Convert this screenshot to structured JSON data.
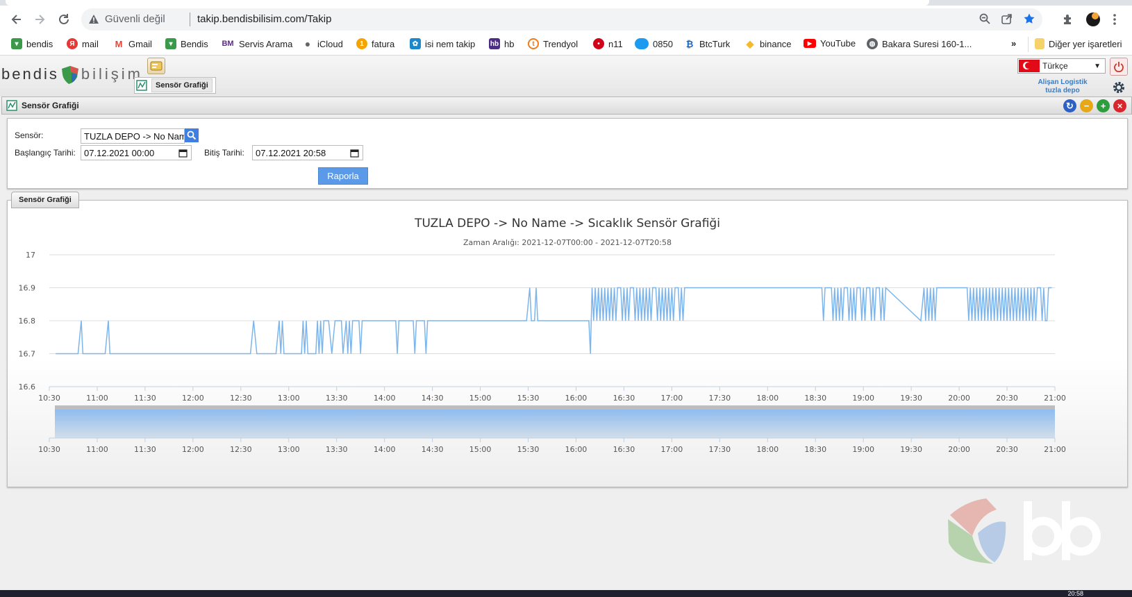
{
  "browser": {
    "security_label": "Güvenli değil",
    "url": "takip.bendisbilisim.com/Takip",
    "bookmarks": [
      {
        "label": "bendis",
        "icon": "bendis-icon",
        "color": "#3a9a4a"
      },
      {
        "label": "mail",
        "icon": "yandex-mail-icon",
        "color": "#e53935"
      },
      {
        "label": "Gmail",
        "icon": "gmail-icon",
        "color": "#ea4335"
      },
      {
        "label": "Bendis",
        "icon": "bendis-icon",
        "color": "#3a9a4a"
      },
      {
        "label": "Servis Arama",
        "icon": "bm-icon",
        "color": "#5b2a86"
      },
      {
        "label": "iCloud",
        "icon": "apple-icon",
        "color": "#666666"
      },
      {
        "label": "fatura",
        "icon": "fatura-icon",
        "color": "#f4a300"
      },
      {
        "label": "isi nem takip",
        "icon": "sensor-icon",
        "color": "#1a88c9"
      },
      {
        "label": "hb",
        "icon": "hb-icon",
        "color": "#4b2e83"
      },
      {
        "label": "Trendyol",
        "icon": "trendyol-icon",
        "color": "#f27a1a"
      },
      {
        "label": "n11",
        "icon": "n11-icon",
        "color": "#d0021b"
      },
      {
        "label": "0850",
        "icon": "cloud-icon",
        "color": "#1d9bf0"
      },
      {
        "label": "BtcTurk",
        "icon": "btcturk-icon",
        "color": "#1565c0"
      },
      {
        "label": "binance",
        "icon": "binance-icon",
        "color": "#f3ba2f"
      },
      {
        "label": "YouTube",
        "icon": "youtube-icon",
        "color": "#ff0000"
      },
      {
        "label": "Bakara Suresi 160-1...",
        "icon": "globe-icon",
        "color": "#5f6368"
      }
    ],
    "more_label": "»",
    "other_bookmarks": "Diğer yer işaretleri"
  },
  "app": {
    "logo_left": "bendis",
    "logo_right": "bilişim",
    "open_tab": "Sensör Grafiği",
    "language": "Türkçe",
    "company_line1": "Alişan Logistik",
    "company_line2": "tuzla depo"
  },
  "window": {
    "title": "Sensör Grafiği",
    "controls": {
      "refresh": "↻",
      "minimize": "−",
      "maximize": "+",
      "close": "×"
    }
  },
  "filter": {
    "sensor_label": "Sensör:",
    "sensor_value": "TUZLA DEPO -> No Name",
    "start_label": "Başlangıç Tarihi:",
    "start_value": "07.12.2021 00:00",
    "end_label": "Bitiş Tarihi:",
    "end_value": "07.12.2021 20:58",
    "report_button": "Raporla"
  },
  "graph_tab": "Sensör Grafiği",
  "colors": {
    "line": "#7cb5ec",
    "accent": "#5b9ae9"
  },
  "chart_data": {
    "type": "line",
    "title": "TUZLA DEPO -> No Name -> Sıcaklık Sensör Grafiği",
    "subtitle": "Zaman Aralığı: 2021-12-07T00:00 - 2021-12-07T20:58",
    "ylim": [
      16.6,
      17
    ],
    "yticks": [
      "16.6",
      "16.7",
      "16.8",
      "16.9",
      "17"
    ],
    "xticks": [
      "10:30",
      "11:00",
      "11:30",
      "12:00",
      "12:30",
      "13:00",
      "13:30",
      "14:00",
      "14:30",
      "15:00",
      "15:30",
      "16:00",
      "16:30",
      "17:00",
      "17:30",
      "18:00",
      "18:30",
      "19:00",
      "19:30",
      "20:00",
      "20:30",
      "21:00"
    ],
    "grid": true,
    "legend": "none",
    "navigator": true,
    "series": [
      {
        "points": [
          [
            "10:34",
            16.7
          ],
          [
            "10:48",
            16.7
          ],
          [
            "10:50",
            16.8
          ],
          [
            "10:51",
            16.7
          ],
          [
            "11:05",
            16.7
          ],
          [
            "11:07",
            16.8
          ],
          [
            "11:08",
            16.7
          ],
          [
            "12:36",
            16.7
          ],
          [
            "12:38",
            16.8
          ],
          [
            "12:40",
            16.7
          ],
          [
            "12:52",
            16.7
          ],
          [
            "12:54",
            16.8
          ],
          [
            "12:55",
            16.7
          ],
          [
            "12:56",
            16.8
          ],
          [
            "12:57",
            16.7
          ],
          [
            "13:08",
            16.7
          ],
          [
            "13:09",
            16.8
          ],
          [
            "13:10",
            16.7
          ],
          [
            "13:11",
            16.8
          ],
          [
            "13:12",
            16.7
          ],
          [
            "13:17",
            16.7
          ],
          [
            "13:18",
            16.8
          ],
          [
            "13:19",
            16.7
          ],
          [
            "13:20",
            16.8
          ],
          [
            "13:21",
            16.7
          ],
          [
            "13:22",
            16.8
          ],
          [
            "13:25",
            16.8
          ],
          [
            "13:27",
            16.7
          ],
          [
            "13:29",
            16.8
          ],
          [
            "13:33",
            16.8
          ],
          [
            "13:34",
            16.7
          ],
          [
            "13:36",
            16.8
          ],
          [
            "13:37",
            16.7
          ],
          [
            "13:38",
            16.8
          ],
          [
            "13:39",
            16.7
          ],
          [
            "13:40",
            16.8
          ],
          [
            "13:44",
            16.8
          ],
          [
            "13:45",
            16.7
          ],
          [
            "13:46",
            16.8
          ],
          [
            "14:07",
            16.8
          ],
          [
            "14:08",
            16.7
          ],
          [
            "14:09",
            16.8
          ],
          [
            "14:18",
            16.8
          ],
          [
            "14:19",
            16.7
          ],
          [
            "14:20",
            16.8
          ],
          [
            "14:25",
            16.8
          ],
          [
            "14:26",
            16.7
          ],
          [
            "14:27",
            16.8
          ],
          [
            "15:29",
            16.8
          ],
          [
            "15:31",
            16.9
          ],
          [
            "15:32",
            16.8
          ],
          [
            "15:34",
            16.8
          ],
          [
            "15:35",
            16.9
          ],
          [
            "15:36",
            16.8
          ],
          [
            "16:08",
            16.8
          ],
          [
            "16:09",
            16.7
          ],
          [
            "16:10",
            16.9
          ],
          [
            "16:11",
            16.8
          ],
          [
            "16:12",
            16.9
          ],
          [
            "16:13",
            16.8
          ],
          [
            "16:14",
            16.9
          ],
          [
            "16:15",
            16.8
          ],
          [
            "16:16",
            16.9
          ],
          [
            "16:17",
            16.8
          ],
          [
            "16:18",
            16.9
          ],
          [
            "16:19",
            16.8
          ],
          [
            "16:20",
            16.9
          ],
          [
            "16:21",
            16.8
          ],
          [
            "16:22",
            16.9
          ],
          [
            "16:23",
            16.8
          ],
          [
            "16:24",
            16.9
          ],
          [
            "16:25",
            16.8
          ],
          [
            "16:26",
            16.9
          ],
          [
            "16:28",
            16.9
          ],
          [
            "16:29",
            16.8
          ],
          [
            "16:30",
            16.9
          ],
          [
            "16:31",
            16.8
          ],
          [
            "16:32",
            16.9
          ],
          [
            "16:33",
            16.8
          ],
          [
            "16:34",
            16.9
          ],
          [
            "16:36",
            16.9
          ],
          [
            "16:37",
            16.8
          ],
          [
            "16:38",
            16.9
          ],
          [
            "16:39",
            16.8
          ],
          [
            "16:40",
            16.9
          ],
          [
            "16:41",
            16.8
          ],
          [
            "16:42",
            16.9
          ],
          [
            "16:43",
            16.8
          ],
          [
            "16:44",
            16.9
          ],
          [
            "16:45",
            16.8
          ],
          [
            "16:46",
            16.9
          ],
          [
            "16:47",
            16.8
          ],
          [
            "16:48",
            16.9
          ],
          [
            "16:50",
            16.9
          ],
          [
            "16:51",
            16.8
          ],
          [
            "16:52",
            16.9
          ],
          [
            "16:53",
            16.8
          ],
          [
            "16:54",
            16.9
          ],
          [
            "16:55",
            16.8
          ],
          [
            "16:56",
            16.9
          ],
          [
            "16:57",
            16.8
          ],
          [
            "16:58",
            16.9
          ],
          [
            "16:59",
            16.8
          ],
          [
            "17:00",
            16.9
          ],
          [
            "17:01",
            16.8
          ],
          [
            "17:02",
            16.9
          ],
          [
            "17:04",
            16.9
          ],
          [
            "17:05",
            16.8
          ],
          [
            "17:06",
            16.9
          ],
          [
            "17:07",
            16.8
          ],
          [
            "17:08",
            16.9
          ],
          [
            "18:34",
            16.9
          ],
          [
            "18:35",
            16.8
          ],
          [
            "18:36",
            16.9
          ],
          [
            "18:40",
            16.9
          ],
          [
            "18:41",
            16.8
          ],
          [
            "18:42",
            16.9
          ],
          [
            "18:43",
            16.8
          ],
          [
            "18:44",
            16.9
          ],
          [
            "18:45",
            16.8
          ],
          [
            "18:46",
            16.9
          ],
          [
            "18:47",
            16.8
          ],
          [
            "18:48",
            16.9
          ],
          [
            "18:50",
            16.9
          ],
          [
            "18:51",
            16.8
          ],
          [
            "18:52",
            16.9
          ],
          [
            "18:53",
            16.8
          ],
          [
            "18:54",
            16.9
          ],
          [
            "18:55",
            16.8
          ],
          [
            "18:56",
            16.9
          ],
          [
            "18:58",
            16.9
          ],
          [
            "18:59",
            16.8
          ],
          [
            "19:00",
            16.9
          ],
          [
            "19:01",
            16.8
          ],
          [
            "19:02",
            16.9
          ],
          [
            "19:04",
            16.9
          ],
          [
            "19:05",
            16.8
          ],
          [
            "19:06",
            16.9
          ],
          [
            "19:07",
            16.8
          ],
          [
            "19:08",
            16.9
          ],
          [
            "19:10",
            16.9
          ],
          [
            "19:11",
            16.8
          ],
          [
            "19:12",
            16.9
          ],
          [
            "19:13",
            16.8
          ],
          [
            "19:14",
            16.9
          ],
          [
            "19:36",
            16.8
          ],
          [
            "19:38",
            16.9
          ],
          [
            "19:39",
            16.8
          ],
          [
            "19:40",
            16.9
          ],
          [
            "19:41",
            16.8
          ],
          [
            "19:42",
            16.9
          ],
          [
            "19:43",
            16.8
          ],
          [
            "19:44",
            16.9
          ],
          [
            "19:45",
            16.8
          ],
          [
            "19:46",
            16.9
          ],
          [
            "20:05",
            16.9
          ],
          [
            "20:06",
            16.8
          ],
          [
            "20:07",
            16.9
          ],
          [
            "20:08",
            16.8
          ],
          [
            "20:09",
            16.9
          ],
          [
            "20:10",
            16.8
          ],
          [
            "20:11",
            16.9
          ],
          [
            "20:12",
            16.8
          ],
          [
            "20:13",
            16.9
          ],
          [
            "20:14",
            16.8
          ],
          [
            "20:15",
            16.9
          ],
          [
            "20:16",
            16.8
          ],
          [
            "20:17",
            16.9
          ],
          [
            "20:18",
            16.8
          ],
          [
            "20:19",
            16.9
          ],
          [
            "20:20",
            16.8
          ],
          [
            "20:21",
            16.9
          ],
          [
            "20:22",
            16.8
          ],
          [
            "20:23",
            16.9
          ],
          [
            "20:24",
            16.8
          ],
          [
            "20:25",
            16.9
          ],
          [
            "20:26",
            16.8
          ],
          [
            "20:27",
            16.9
          ],
          [
            "20:28",
            16.8
          ],
          [
            "20:29",
            16.9
          ],
          [
            "20:30",
            16.8
          ],
          [
            "20:31",
            16.9
          ],
          [
            "20:32",
            16.8
          ],
          [
            "20:33",
            16.9
          ],
          [
            "20:34",
            16.8
          ],
          [
            "20:35",
            16.9
          ],
          [
            "20:36",
            16.8
          ],
          [
            "20:37",
            16.9
          ],
          [
            "20:38",
            16.8
          ],
          [
            "20:39",
            16.9
          ],
          [
            "20:40",
            16.8
          ],
          [
            "20:41",
            16.9
          ],
          [
            "20:42",
            16.8
          ],
          [
            "20:43",
            16.9
          ],
          [
            "20:44",
            16.8
          ],
          [
            "20:45",
            16.9
          ],
          [
            "20:46",
            16.8
          ],
          [
            "20:47",
            16.9
          ],
          [
            "20:48",
            16.8
          ],
          [
            "20:49",
            16.9
          ],
          [
            "20:51",
            16.9
          ],
          [
            "20:52",
            16.8
          ],
          [
            "20:53",
            16.9
          ],
          [
            "20:54",
            16.8
          ],
          [
            "20:55",
            16.8
          ],
          [
            "20:56",
            16.9
          ],
          [
            "20:58",
            16.9
          ]
        ]
      }
    ]
  },
  "taskbar": {
    "clock": "20:58"
  }
}
